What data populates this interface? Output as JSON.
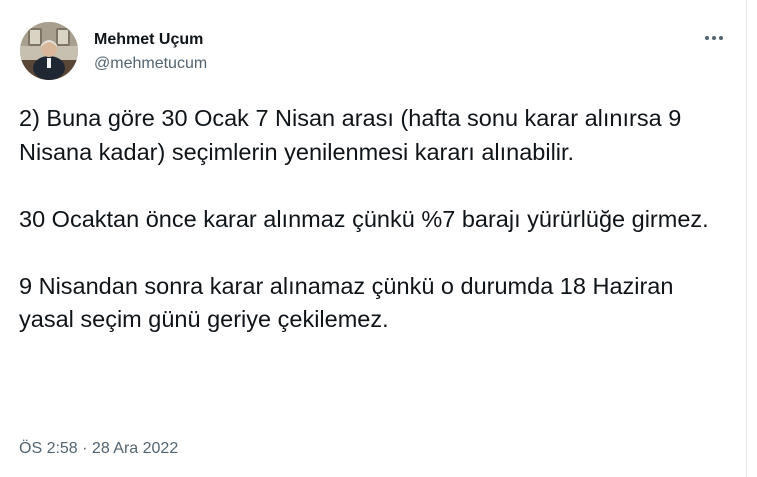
{
  "author": {
    "name": "Mehmet Uçum",
    "handle": "@mehmetucum"
  },
  "more_icon": "more-horizontal-icon",
  "tweet": {
    "paragraphs": [
      "2) Buna göre 30 Ocak 7 Nisan arası (hafta sonu karar alınırsa 9 Nisana kadar) seçimlerin yenilenmesi kararı alınabilir.",
      "30 Ocaktan önce karar alınmaz çünkü %7 barajı yürürlüğe girmez.",
      "9 Nisandan sonra karar alınamaz çünkü o durumda 18 Haziran yasal seçim günü geriye çekilemez."
    ]
  },
  "timestamp": "ÖS 2:58 · 28 Ara 2022",
  "colors": {
    "text": "#0f1419",
    "secondary": "#536471",
    "border": "#e6e9ec"
  }
}
